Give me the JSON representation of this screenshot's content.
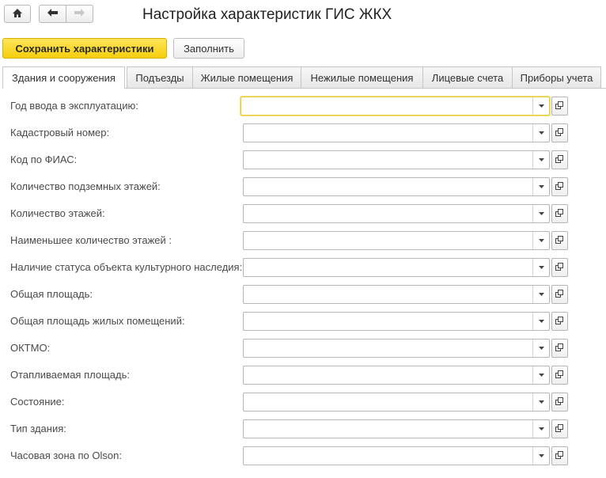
{
  "window": {
    "title": "Настройка характеристик ГИС ЖКХ"
  },
  "toolbar": {
    "home_icon": "home-icon",
    "back_icon": "arrow-left-icon",
    "forward_icon": "arrow-right-icon"
  },
  "actions": {
    "save_label": "Сохранить характеристики",
    "fill_label": "Заполнить"
  },
  "tabs": [
    {
      "label": "Здания и сооружения",
      "active": true
    },
    {
      "label": "Подъезды",
      "active": false
    },
    {
      "label": "Жилые помещения",
      "active": false
    },
    {
      "label": "Нежилые помещения",
      "active": false
    },
    {
      "label": "Лицевые счета",
      "active": false
    },
    {
      "label": "Приборы учета",
      "active": false
    }
  ],
  "fields": [
    {
      "label": "Год ввода в эксплуатацию:",
      "value": ""
    },
    {
      "label": "Кадастровый номер:",
      "value": ""
    },
    {
      "label": "Код по ФИАС:",
      "value": ""
    },
    {
      "label": "Количество подземных этажей:",
      "value": ""
    },
    {
      "label": "Количество этажей:",
      "value": ""
    },
    {
      "label": "Наименьшее количество этажей :",
      "value": ""
    },
    {
      "label": "Наличие статуса объекта культурного наследия:",
      "value": ""
    },
    {
      "label": "Общая площадь:",
      "value": ""
    },
    {
      "label": "Общая площадь жилых помещений:",
      "value": ""
    },
    {
      "label": "ОКТМО:",
      "value": ""
    },
    {
      "label": "Отапливаемая площадь:",
      "value": ""
    },
    {
      "label": "Состояние:",
      "value": ""
    },
    {
      "label": "Тип здания:",
      "value": ""
    },
    {
      "label": "Часовая зона по Olson:",
      "value": ""
    }
  ],
  "colors": {
    "primary_button": "#f5cf0b",
    "focus_border": "#e8cd36",
    "border": "#b5b5b5"
  }
}
